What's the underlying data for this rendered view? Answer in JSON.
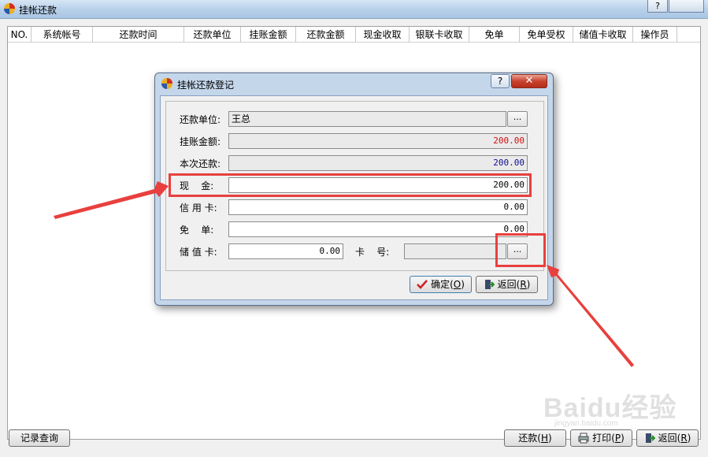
{
  "window": {
    "title": "挂帐还款",
    "help_label": "?"
  },
  "grid": {
    "columns": [
      "NO.",
      "系统帐号",
      "还款时间",
      "还款单位",
      "挂账金额",
      "还款金额",
      "现金收取",
      "银联卡收取",
      "免单",
      "免单受权",
      "储值卡收取",
      "操作员"
    ]
  },
  "footer": {
    "query_label": "记录查询",
    "repay_label": "还款",
    "repay_key": "H",
    "print_label": "打印",
    "print_key": "P",
    "back_label": "返回",
    "back_key": "R"
  },
  "dialog": {
    "title": "挂帐还款登记",
    "help_label": "?",
    "close_label": "✕",
    "fields": {
      "unit": {
        "label": "还款单位:",
        "value": "王总",
        "browse": "..."
      },
      "credit_amount": {
        "label": "挂账金额:",
        "value": "200.00",
        "color": "#d01010"
      },
      "this_repay": {
        "label": "本次还款:",
        "value": "200.00",
        "color": "#101090"
      },
      "cash": {
        "label": "现    金:",
        "value": "200.00"
      },
      "credit_card": {
        "label": "信 用 卡:",
        "value": "0.00"
      },
      "waive": {
        "label": "免    单:",
        "value": "0.00"
      },
      "stored_card": {
        "label": "储 值 卡:",
        "value": "0.00"
      },
      "card_no": {
        "label": "卡    号:",
        "value": "",
        "browse": "..."
      }
    },
    "ok_label": "确定",
    "ok_key": "O",
    "back_label": "返回",
    "back_key": "R"
  },
  "watermark": {
    "brand": "Baidu经验",
    "url": "jingyan.baidu.com"
  },
  "colors": {
    "annotation": "#e8403e",
    "accent": "#2a68b8"
  }
}
